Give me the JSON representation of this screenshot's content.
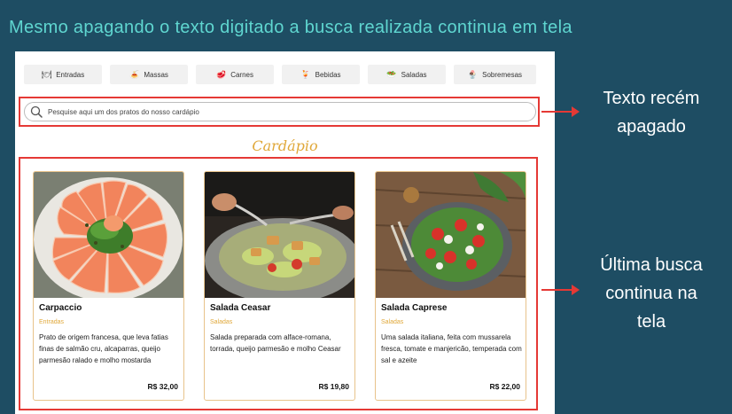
{
  "banner": "Mesmo apagando o texto digitado a busca realizada continua em tela",
  "categories": [
    {
      "label": "Entradas",
      "icon": "🍽"
    },
    {
      "label": "Massas",
      "icon": "🍝"
    },
    {
      "label": "Carnes",
      "icon": "🥩"
    },
    {
      "label": "Bebidas",
      "icon": "🍹"
    },
    {
      "label": "Saladas",
      "icon": "🥗"
    },
    {
      "label": "Sobremesas",
      "icon": "🍨"
    }
  ],
  "search": {
    "placeholder": "Pesquise aqui um dos pratos do nosso cardápio",
    "value": ""
  },
  "menu_title": "Cardápio",
  "dishes": [
    {
      "name": "Carpaccio",
      "category": "Entradas",
      "description": "Prato de origem francesa, que leva fatias finas de salmão cru, alcaparras, queijo parmesão ralado e molho mostarda",
      "price": "R$ 32,00"
    },
    {
      "name": "Salada Ceasar",
      "category": "Saladas",
      "description": "Salada preparada com alface-romana, torrada, queijo parmesão e molho Ceasar",
      "price": "R$ 19,80"
    },
    {
      "name": "Salada Caprese",
      "category": "Saladas",
      "description": "Uma salada italiana, feita com mussarela fresca, tomate e manjericão, temperada com sal e azeite",
      "price": "R$ 22,00"
    }
  ],
  "annotations": {
    "search_note": [
      "Texto recém",
      "apagado"
    ],
    "results_note": [
      "Última busca",
      "continua na",
      "tela"
    ]
  },
  "colors": {
    "background": "#1e4d63",
    "banner_text": "#5fd6d0",
    "highlight": "#e53935",
    "accent": "#e0a83a"
  }
}
